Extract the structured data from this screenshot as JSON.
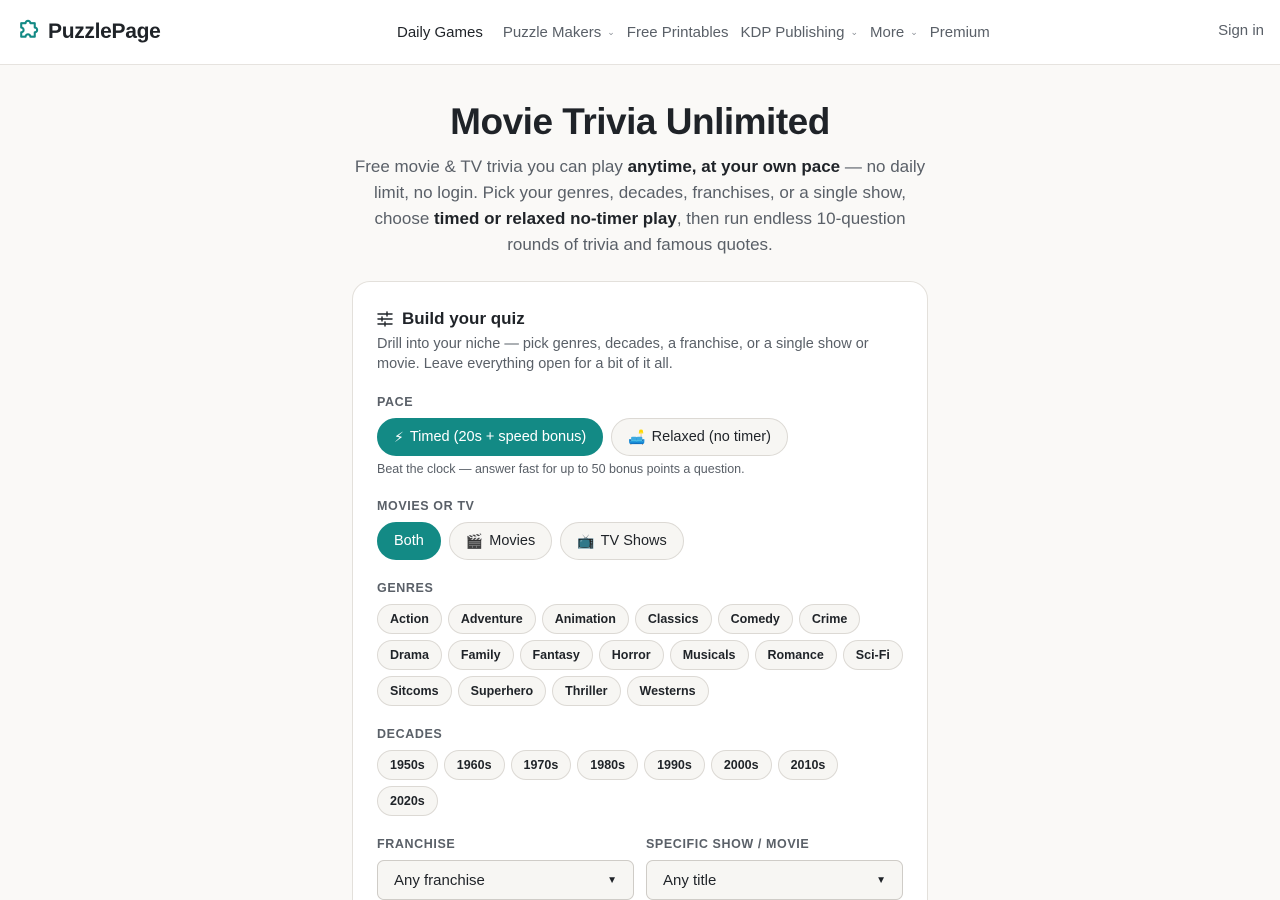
{
  "brand": {
    "name": "PuzzlePage",
    "logo_icon": "puzzle-piece-icon",
    "accent": "#138a85"
  },
  "nav": {
    "items": [
      {
        "label": "Daily Games",
        "active": true,
        "has_dropdown": false
      },
      {
        "label": "Puzzle Makers",
        "active": false,
        "has_dropdown": true
      },
      {
        "label": "Free Printables",
        "active": false,
        "has_dropdown": false
      },
      {
        "label": "KDP Publishing",
        "active": false,
        "has_dropdown": true
      },
      {
        "label": "More",
        "active": false,
        "has_dropdown": true
      },
      {
        "label": "Premium",
        "active": false,
        "has_dropdown": false
      }
    ],
    "signin_label": "Sign in"
  },
  "hero": {
    "title": "Movie Trivia Unlimited",
    "subtitle": {
      "part1": "Free movie & TV trivia you can play ",
      "bold1": "anytime, at your own pace",
      "part2": " — no daily limit, no login. Pick your genres, decades, franchises, or a single show, choose ",
      "bold2": "timed or relaxed no-timer play",
      "part3": ", then run endless 10-question rounds of trivia and famous quotes."
    }
  },
  "quiz_builder": {
    "title": "Build your quiz",
    "title_icon": "sliders-icon",
    "description": "Drill into your niche — pick genres, decades, a franchise, or a single show or movie. Leave everything open for a bit of it all.",
    "pace": {
      "label": "PACE",
      "options": [
        {
          "emoji": "⚡",
          "label": "Timed (20s + speed bonus)",
          "selected": true
        },
        {
          "emoji": "🛋️",
          "label": "Relaxed (no timer)",
          "selected": false
        }
      ],
      "hint": "Beat the clock — answer fast for up to 50 bonus points a question."
    },
    "media": {
      "label": "MOVIES OR TV",
      "options": [
        {
          "emoji": "",
          "label": "Both",
          "selected": true
        },
        {
          "emoji": "🎬",
          "label": "Movies",
          "selected": false
        },
        {
          "emoji": "📺",
          "label": "TV Shows",
          "selected": false
        }
      ]
    },
    "genres": {
      "label": "GENRES",
      "options": [
        "Action",
        "Adventure",
        "Animation",
        "Classics",
        "Comedy",
        "Crime",
        "Drama",
        "Family",
        "Fantasy",
        "Horror",
        "Musicals",
        "Romance",
        "Sci-Fi",
        "Sitcoms",
        "Superhero",
        "Thriller",
        "Westerns"
      ]
    },
    "decades": {
      "label": "DECADES",
      "options": [
        "1950s",
        "1960s",
        "1970s",
        "1980s",
        "1990s",
        "2000s",
        "2010s",
        "2020s"
      ]
    },
    "franchise": {
      "label": "FRANCHISE",
      "value": "Any franchise"
    },
    "title_select": {
      "label": "SPECIFIC SHOW / MOVIE",
      "value": "Any title"
    }
  }
}
